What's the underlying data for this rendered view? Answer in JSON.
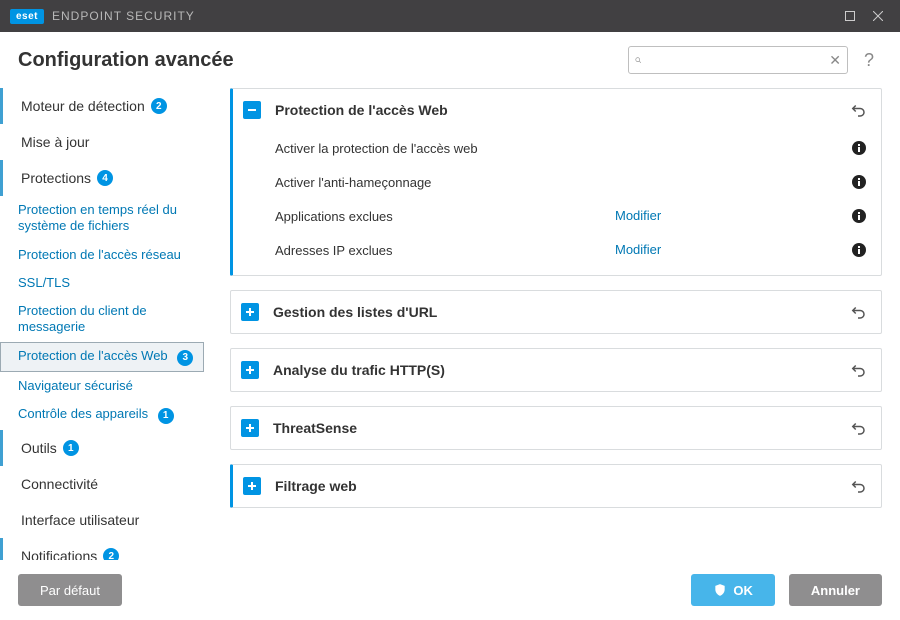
{
  "titlebar": {
    "brand_badge": "eset",
    "brand_text": "ENDPOINT SECURITY"
  },
  "header": {
    "title": "Configuration avancée",
    "search_placeholder": ""
  },
  "sidebar": {
    "items": [
      {
        "label": "Moteur de détection",
        "badge": "2",
        "active_edge": true
      },
      {
        "label": "Mise à jour",
        "badge": null
      },
      {
        "label": "Protections",
        "badge": "4",
        "active_edge": true
      }
    ],
    "subitems": [
      {
        "label": "Protection en temps réel du système de fichiers",
        "badge": null
      },
      {
        "label": "Protection de l'accès réseau",
        "badge": null
      },
      {
        "label": "SSL/TLS",
        "badge": null
      },
      {
        "label": "Protection du client de messagerie",
        "badge": null
      },
      {
        "label": "Protection de l'accès Web",
        "badge": "3",
        "selected": true
      },
      {
        "label": "Navigateur sécurisé",
        "badge": null
      },
      {
        "label": "Contrôle des appareils",
        "badge": "1"
      }
    ],
    "items2": [
      {
        "label": "Outils",
        "badge": "1",
        "active_edge": true
      },
      {
        "label": "Connectivité",
        "badge": null
      },
      {
        "label": "Interface utilisateur",
        "badge": null
      },
      {
        "label": "Notifications",
        "badge": "2",
        "active_edge": true
      }
    ]
  },
  "sections": [
    {
      "title": "Protection de l'accès Web",
      "expanded": true,
      "rows": [
        {
          "label": "Activer la protection de l'accès web",
          "type": "toggle",
          "value": true
        },
        {
          "label": "Activer l'anti-hameçonnage",
          "type": "toggle",
          "value": true
        },
        {
          "label": "Applications exclues",
          "type": "link",
          "link_text": "Modifier"
        },
        {
          "label": "Adresses IP exclues",
          "type": "link",
          "link_text": "Modifier"
        }
      ]
    },
    {
      "title": "Gestion des listes d'URL",
      "expanded": false
    },
    {
      "title": "Analyse du trafic HTTP(S)",
      "expanded": false
    },
    {
      "title": "ThreatSense",
      "expanded": false
    },
    {
      "title": "Filtrage web",
      "expanded": false
    }
  ],
  "footer": {
    "default_label": "Par défaut",
    "ok_label": "OK",
    "cancel_label": "Annuler"
  }
}
